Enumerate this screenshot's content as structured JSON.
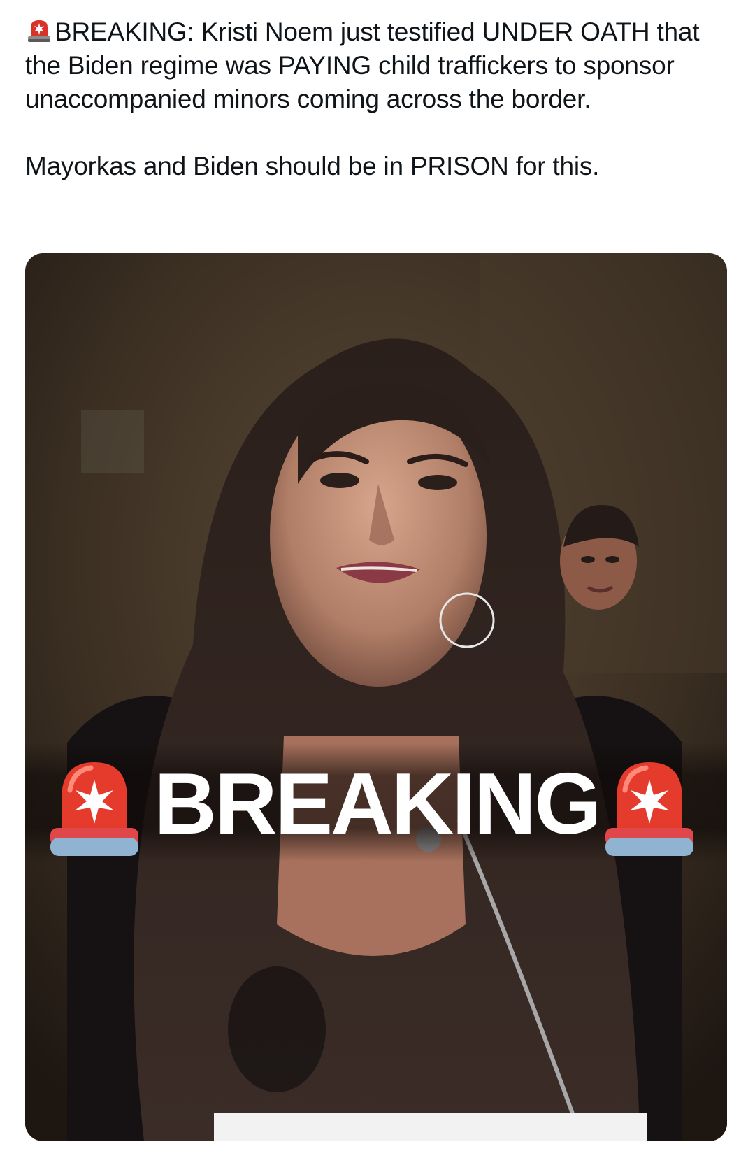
{
  "post": {
    "paragraph_1": "BREAKING: Kristi Noem just testified UNDER OATH that the Biden regime was PAYING child traffickers to sponsor unaccompanied minors coming across the border.",
    "paragraph_2": "Mayorkas and Biden should be in PRISON for this.",
    "lead_icon": "police-light-emoji"
  },
  "media": {
    "overlay_text": "BREAKING",
    "overlay_icons": [
      "police-light-emoji",
      "police-light-emoji"
    ],
    "colors": {
      "background": "#2b221b",
      "overlay_text": "#ffffff",
      "siren_red": "#e53b2c",
      "siren_base": "#8fb3d0"
    }
  }
}
